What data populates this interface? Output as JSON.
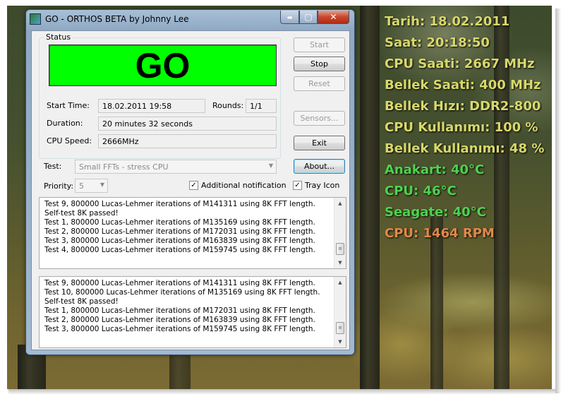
{
  "window": {
    "title": "GO - ORTHOS BETA by Johnny Lee",
    "minimize_glyph": "▬",
    "maximize_glyph": "▢",
    "close_glyph": "✕"
  },
  "status": {
    "group_label": "Status",
    "indicator": "GO",
    "start_time_label": "Start Time:",
    "start_time_value": "18.02.2011 19:58",
    "rounds_label": "Rounds:",
    "rounds_value": "1/1",
    "duration_label": "Duration:",
    "duration_value": "20 minutes 32 seconds",
    "cpu_speed_label": "CPU Speed:",
    "cpu_speed_value": "2666MHz"
  },
  "buttons": {
    "start": "Start",
    "stop": "Stop",
    "reset": "Reset",
    "sensors": "Sensors...",
    "exit": "Exit",
    "about": "About..."
  },
  "test": {
    "label": "Test:",
    "value": "Small FFTs - stress CPU",
    "priority_label": "Priority:",
    "priority_value": "5",
    "additional_notification_label": "Additional notification",
    "additional_notification_checked": true,
    "tray_icon_label": "Tray Icon",
    "tray_icon_checked": true,
    "check_glyph": "✓"
  },
  "log1": [
    "Test 9, 800000 Lucas-Lehmer iterations of M141311 using 8K FFT length.",
    "Self-test 8K passed!",
    "Test 1, 800000 Lucas-Lehmer iterations of M135169 using 8K FFT length.",
    "Test 2, 800000 Lucas-Lehmer iterations of M172031 using 8K FFT length.",
    "Test 3, 800000 Lucas-Lehmer iterations of M163839 using 8K FFT length.",
    "Test 4, 800000 Lucas-Lehmer iterations of M159745 using 8K FFT length."
  ],
  "log2": [
    "Test 9, 800000 Lucas-Lehmer iterations of M141311 using 8K FFT length.",
    "Test 10, 800000 Lucas-Lehmer iterations of M135169 using 8K FFT length.",
    "Self-test 8K passed!",
    "Test 1, 800000 Lucas-Lehmer iterations of M172031 using 8K FFT length.",
    "Test 2, 800000 Lucas-Lehmer iterations of M163839 using 8K FFT length.",
    "Test 3, 800000 Lucas-Lehmer iterations of M159745 using 8K FFT length."
  ],
  "overlay": [
    {
      "text": "Tarih: 18.02.2011",
      "color": "#d8d86a"
    },
    {
      "text": "Saat: 20:18:50",
      "color": "#d8d86a"
    },
    {
      "text": "CPU Saati: 2667 MHz",
      "color": "#d8d86a"
    },
    {
      "text": "Bellek Saati: 400 MHz",
      "color": "#d8d86a"
    },
    {
      "text": "Bellek Hızı: DDR2-800",
      "color": "#d8d86a"
    },
    {
      "text": "CPU Kullanımı: 100 %",
      "color": "#d8d86a"
    },
    {
      "text": "Bellek Kullanımı: 48 %",
      "color": "#d8d86a"
    },
    {
      "text": "Anakart: 40°C",
      "color": "#4fd24f"
    },
    {
      "text": "CPU: 46°C",
      "color": "#4fd24f"
    },
    {
      "text": "Seagate: 40°C",
      "color": "#4fd24f"
    },
    {
      "text": "CPU: 1464 RPM",
      "color": "#e0894a"
    }
  ],
  "colors": {
    "go_indicator": "#00ff00"
  }
}
